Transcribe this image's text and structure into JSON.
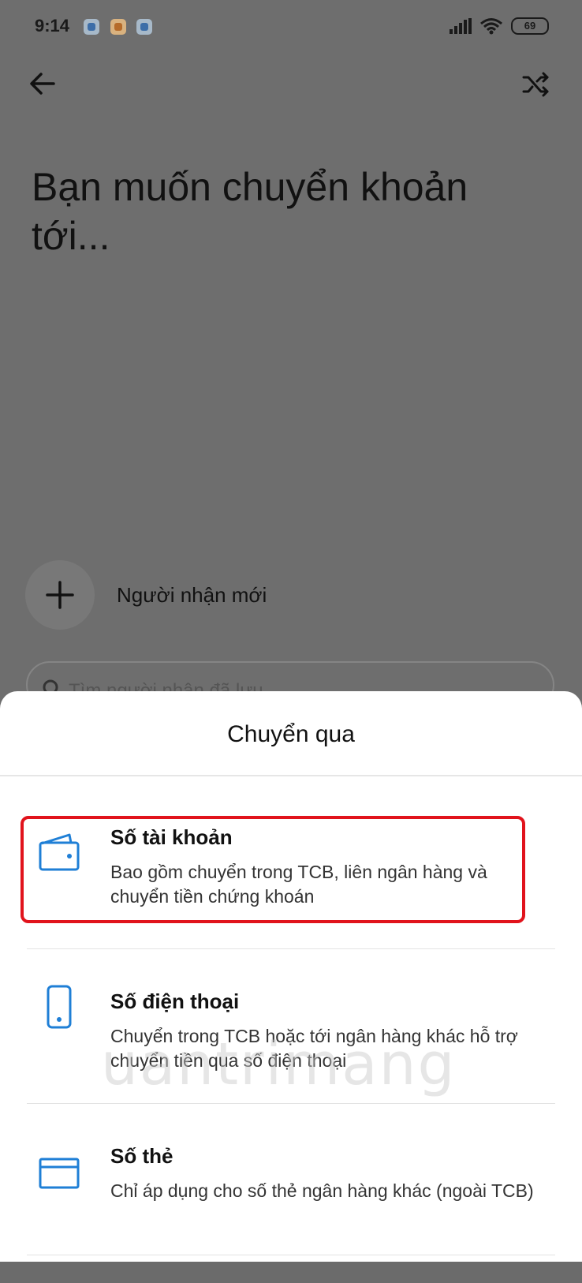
{
  "status_bar": {
    "time": "9:14",
    "battery": "69"
  },
  "header": {
    "title": "Bạn muốn chuyển khoản tới..."
  },
  "new_recipient": {
    "label": "Người nhận mới"
  },
  "search": {
    "placeholder": "Tìm người nhận đã lưu"
  },
  "sheet": {
    "title": "Chuyển qua",
    "options": [
      {
        "title": "Số tài khoản",
        "desc": "Bao gồm chuyển trong TCB, liên ngân hàng và chuyển tiền chứng khoán",
        "icon": "wallet-icon"
      },
      {
        "title": "Số điện thoại",
        "desc": "Chuyển trong TCB hoặc tới ngân hàng khác hỗ trợ chuyển tiền qua số điện thoại",
        "icon": "phone-icon"
      },
      {
        "title": "Số thẻ",
        "desc": "Chỉ áp dụng cho số thẻ ngân hàng khác (ngoài TCB)",
        "icon": "card-icon"
      }
    ]
  },
  "watermark": "uantrimang",
  "colors": {
    "accent_blue": "#1f7fd6",
    "highlight_red": "#e1131c",
    "overlay": "#6e6e6e"
  }
}
